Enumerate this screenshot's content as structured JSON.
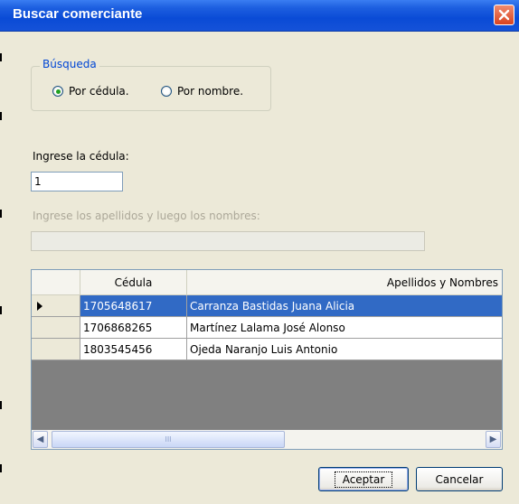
{
  "window": {
    "title": "Buscar comerciante",
    "close_icon": "close-icon"
  },
  "search_group": {
    "legend": "Búsqueda",
    "options": [
      {
        "label": "Por cédula.",
        "selected": true
      },
      {
        "label": "Por nombre.",
        "selected": false
      }
    ]
  },
  "cedula": {
    "label": "Ingrese la cédula:",
    "value": "1"
  },
  "nombres": {
    "label": "Ingrese los apellidos y luego los nombres:",
    "value": ""
  },
  "grid": {
    "columns": [
      "Cédula",
      "Apellidos y Nombres"
    ],
    "rows": [
      {
        "cedula": "1705648617",
        "nombres": "Carranza Bastidas Juana Alicia",
        "selected": true
      },
      {
        "cedula": "1706868265",
        "nombres": "Martínez Lalama José Alonso",
        "selected": false
      },
      {
        "cedula": "1803545456",
        "nombres": "Ojeda Naranjo Luis Antonio",
        "selected": false
      }
    ],
    "scroll_left_icon": "scroll-left-arrow-icon",
    "scroll_right_icon": "scroll-right-arrow-icon",
    "thumb_grip": "III",
    "selection_color": "#316ac5"
  },
  "buttons": {
    "accept": "Aceptar",
    "cancel": "Cancelar"
  }
}
